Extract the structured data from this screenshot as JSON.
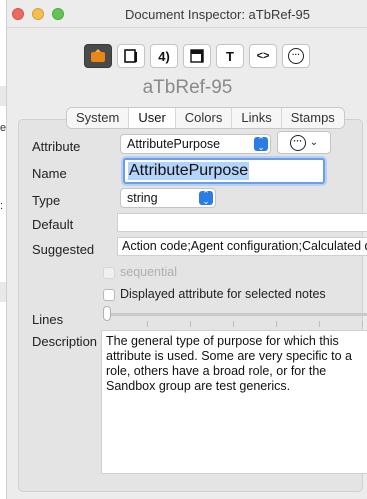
{
  "window": {
    "title": "Document Inspector: aTbRef-95"
  },
  "toolbar": {
    "buttons": [
      {
        "name": "general-pane-icon",
        "glyph": ""
      },
      {
        "name": "text-pane-icon",
        "glyph": ""
      },
      {
        "name": "quickstamp-pane-icon",
        "glyph": "4)"
      },
      {
        "name": "appearance-pane-icon",
        "glyph": ""
      },
      {
        "name": "action-pane-icon",
        "glyph": "T"
      },
      {
        "name": "code-pane-icon",
        "glyph": "<>"
      },
      {
        "name": "more-pane-icon",
        "glyph": "···"
      }
    ]
  },
  "note_name": "aTbRef-95",
  "tabs": [
    {
      "label": "System"
    },
    {
      "label": "User"
    },
    {
      "label": "Colors"
    },
    {
      "label": "Links"
    },
    {
      "label": "Stamps"
    }
  ],
  "selected_tab": "User",
  "fields": {
    "attribute_label": "Attribute",
    "attribute_value": "AttributePurpose",
    "name_label": "Name",
    "name_value": "AttributePurpose",
    "type_label": "Type",
    "type_value": "string",
    "default_label": "Default",
    "default_value": "",
    "suggested_label": "Suggested",
    "suggested_value": "Action code;Agent configuration;Calculated d",
    "sequential_label": "sequential",
    "displayed_label": "Displayed attribute for selected notes",
    "lines_label": "Lines",
    "description_label": "Description",
    "description_value": "The general type of purpose for which this attribute is used. Some are very specific to a role, others have a broad role, or for the Sandbox group are test generics."
  },
  "background_fragments": [
    "e",
    ":"
  ],
  "colors": {
    "accent": "#2c7ce5",
    "focus_ring": "#6a9ee8",
    "selection": "#b3d3fa"
  }
}
